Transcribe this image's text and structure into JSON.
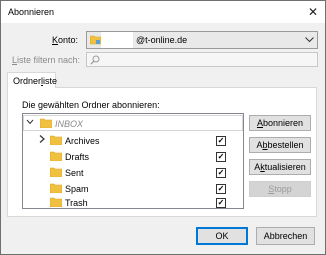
{
  "window": {
    "title": "Abonnieren",
    "close_glyph": "✕"
  },
  "account": {
    "label_prefix": "",
    "label_mnemonic": "K",
    "label_rest": "onto:",
    "value": "@t-online.de",
    "icon": "account-folder-icon"
  },
  "filter": {
    "label_prefix": "",
    "label_mnemonic": "L",
    "label_rest": "iste filtern nach:",
    "value": "",
    "placeholder": ""
  },
  "tabs": [
    {
      "pre": "Ordner",
      "mnemonic": "l",
      "post": "iste"
    }
  ],
  "panel": {
    "label": "Die gewählten Ordner abonnieren:"
  },
  "folders": [
    {
      "name": "INBOX",
      "checked": false,
      "italic": true,
      "has_children": false
    },
    {
      "name": "Archives",
      "checked": true,
      "italic": false,
      "has_children": true
    },
    {
      "name": "Drafts",
      "checked": true,
      "italic": false,
      "has_children": false
    },
    {
      "name": "Sent",
      "checked": true,
      "italic": false,
      "has_children": false
    },
    {
      "name": "Spam",
      "checked": true,
      "italic": false,
      "has_children": false
    },
    {
      "name": "Trash",
      "checked": true,
      "italic": false,
      "has_children": false
    }
  ],
  "buttons": {
    "subscribe": {
      "pre": "",
      "mnemonic": "A",
      "post": "bonnieren"
    },
    "unsubscribe": {
      "pre": "A",
      "mnemonic": "b",
      "post": "bestellen"
    },
    "refresh": {
      "pre": "A",
      "mnemonic": "k",
      "post": "tualisieren"
    },
    "stop": {
      "pre": "",
      "mnemonic": "S",
      "post": "topp"
    },
    "ok": "OK",
    "cancel": "Abbrechen"
  },
  "colors": {
    "accent": "#0078d7",
    "folder": "#f0c040",
    "folder_dark": "#d9a520"
  }
}
